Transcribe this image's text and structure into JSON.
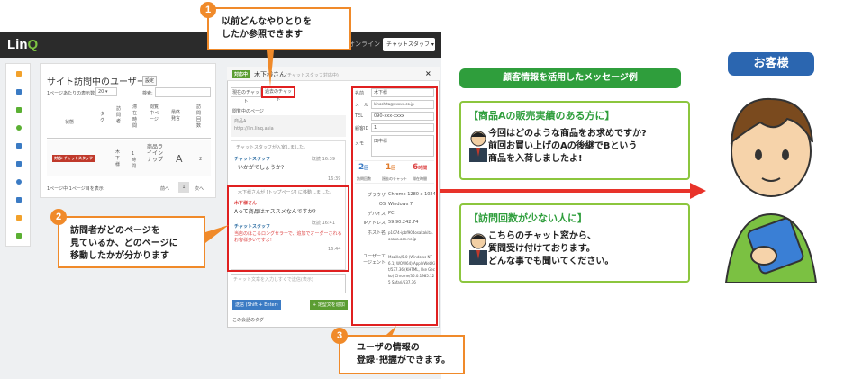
{
  "app": {
    "logo_main": "Lin",
    "logo_q": "Q",
    "online_label": "オンライン 1人",
    "staff_button": "チャットスタッフ ▾"
  },
  "visitors_panel": {
    "title": "サイト訪問中のユーザー",
    "sort_button": "設定",
    "per_page_label": "1ページあたりの表示数",
    "per_page_value": "20",
    "search_label": "検索:",
    "columns": [
      "状態",
      "タグ",
      "訪問者",
      "滞在時間",
      "閲覧中ページ",
      "最終発言",
      "訪問回数"
    ],
    "row": {
      "tag": "対応: チャットスタッフ",
      "visitor": "木下様",
      "time": "1時間",
      "page": "商品ライインナップ",
      "last": "A",
      "visits": "2"
    },
    "pagination_info": "1ページ中 1ページ目を表示",
    "prev": "前へ",
    "page": "1",
    "next": "次へ"
  },
  "chat_modal": {
    "badge": "対応中",
    "header_name": "木下様さん",
    "header_status": "(チャットスタッフ対応中)",
    "close": "×",
    "tab_current": "現在のチャット",
    "tab_history": "過去のチャット",
    "viewing_label": "閲覧中のページ",
    "viewing_title": "商品A",
    "viewing_url": "http://lin.linq.asia",
    "system_msg": "チャットスタッフが入室しました。",
    "staff_name": "チャットスタッフ",
    "staff_msg": "いかがでしょうか?",
    "time1": "既読  16:39",
    "time2": "16:39",
    "visitor_page_msg": "木下様さんが [トップページ] に移動しました。",
    "visitor_name": "木下様さん",
    "visitor_msg": "Aって商品はオススメなんですか?",
    "time3": "既読  16:41",
    "staff_name2": "チャットスタッフ",
    "staff_msg2": "当店のはこるロングセラーで、追加でオーダーされるお客様多いですよ!",
    "time4": "16:44",
    "input_placeholder": "チャット文章を入力しすぐで送信(表示)",
    "send_button": "送信 (Shift + Enter)",
    "template_button": "+ 定型文を追加",
    "memo_label": "この会話のタグ"
  },
  "user_info": {
    "name_label": "名前",
    "name_value": "木下様",
    "mail_label": "メール",
    "mail_value": "kinoshita@xxxxx.co.jp",
    "tel_label": "TEL",
    "tel_value": "090-xxx-xxxx",
    "id_label": "顧客ID",
    "id_value": "1",
    "memo_label": "メモ",
    "memo_value": "田中様",
    "stats": [
      {
        "num": "2",
        "unit": "回",
        "label": "訪問回数"
      },
      {
        "num": "1",
        "unit": "回",
        "label": "過去のチャット"
      },
      {
        "num": "6",
        "unit": "時間",
        "label": "滞在時間"
      }
    ],
    "browser_label": "ブラウザ",
    "browser_value": "Chrome  1280 x 1024",
    "os_label": "OS",
    "os_value": "Windows 7",
    "device_label": "デバイス",
    "device_value": "PC",
    "ip_label": "IPアドレス",
    "ip_value": "59.90.242.74",
    "host_label": "ホスト名",
    "host_value": "p1074-ipbf904osakakita.osaka.ocn.ne.jp",
    "ua_label": "ユーザーエージェント",
    "ua_value": "Mozilla/5.0 (Windows NT 6.1; WOW64) AppleWebKit/537.36 (KHTML, like Gecko) Chrome/36.0.1985.125 Safari/537.36"
  },
  "callouts": {
    "c1_num": "1",
    "c1_line1": "以前どんなやりとりを",
    "c1_line2": "したか参照できます",
    "c2_num": "2",
    "c2_line1": "訪問者がどのページを",
    "c2_line2": "見ているか、どのページに",
    "c2_line3": "移動したかが分かります",
    "c3_num": "3",
    "c3_line1": "ユーザの情報の",
    "c3_line2": "登録･把握ができます。"
  },
  "examples": {
    "header": "顧客情報を活用したメッセージ例",
    "ex1_title": "【商品Aの販売実績のある方に】",
    "ex1_line1": "今回はどのような商品をお求めですか?",
    "ex1_line2": "前回お買い上げのAの後継でBという",
    "ex1_line3": "商品を入荷しましたよ!",
    "ex2_title": "【訪問回数が少ない人に】",
    "ex2_line1": "こちらのチャット窓から、",
    "ex2_line2": "質問受け付けております。",
    "ex2_line3": "どんな事でも聞いてください。"
  },
  "customer": {
    "label": "お客様"
  },
  "colors": {
    "orange": "#f08a2a",
    "green": "#2f9e3c",
    "red": "#e02020",
    "blue": "#2b66b0"
  }
}
